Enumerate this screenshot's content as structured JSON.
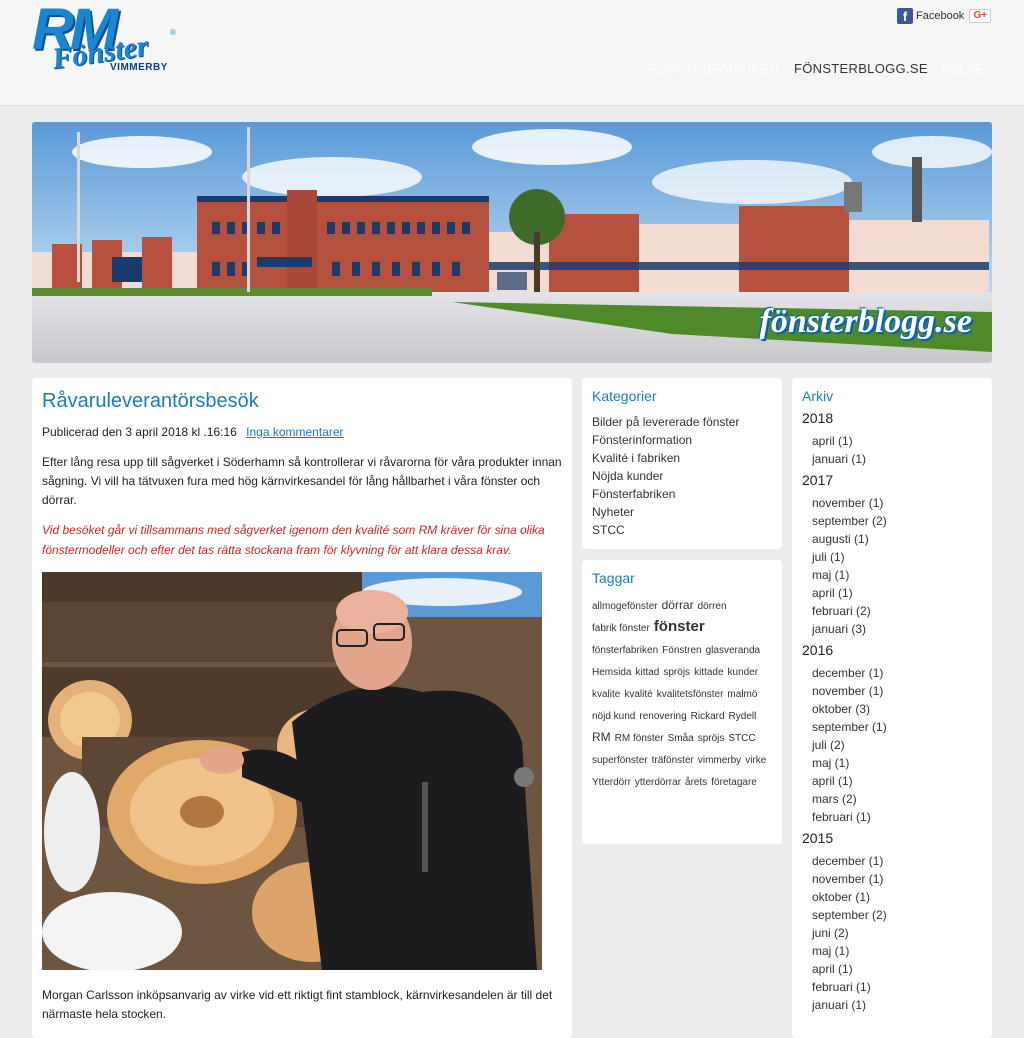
{
  "header": {
    "logo": {
      "main": "RM",
      "sub": "Fönster",
      "city": "VIMMERBY",
      "reg": "®"
    },
    "social": {
      "facebook_label": "Facebook",
      "gplus_label": "G+"
    },
    "nav": [
      {
        "label": "FÖNSTERFABRIKEN"
      },
      {
        "label": "FÖNSTERBLOGG.SE"
      },
      {
        "label": "RM.SE"
      }
    ]
  },
  "banner": {
    "caption": "fönsterblogg.se"
  },
  "post": {
    "title": "Råvaruleverantörsbesök",
    "meta": "Publicerad den 3 april 2018 kl .16:16",
    "comments_link": "Inga kommentarer",
    "body": "Efter lång resa upp till sågverket i Söderhamn så kontrollerar vi råvarorna för våra produkter innan sågning. Vi vill ha tätvuxen fura med hög kärnvirkesandel för lång hållbarhet i våra fönster och dörrar.",
    "quote": "Vid besöket går vi tillsammans med sågverket igenom den kvalité som RM kräver för sina olika fönstermodeller och efter det tas rätta stockana fram för klyvning för att klara dessa krav.",
    "caption": "Morgan Carlsson inköpsanvarig av virke vid ett riktigt fint stamblock, kärnvirkesandelen är till det närmaste hela stocken."
  },
  "categories": {
    "title": "Kategorier",
    "items": [
      "Bilder på levererade fönster",
      "Fönsterinformation",
      "Kvalité i fabriken",
      "Nöjda kunder",
      "Fönsterfabriken",
      "Nyheter",
      "STCC"
    ]
  },
  "tags": {
    "title": "Taggar",
    "items": [
      {
        "label": "allmogefönster",
        "size": "sm"
      },
      {
        "label": "dörrar",
        "size": "md"
      },
      {
        "label": "dörren",
        "size": "sm"
      },
      {
        "label": "fabrik fönster",
        "size": "sm"
      },
      {
        "label": "fönster",
        "size": "lg"
      },
      {
        "label": "fönsterfabriken",
        "size": "sm"
      },
      {
        "label": "Fönstren",
        "size": "sm"
      },
      {
        "label": "glasveranda",
        "size": "sm"
      },
      {
        "label": "Hemsida",
        "size": "sm"
      },
      {
        "label": "kittad",
        "size": "sm"
      },
      {
        "label": "spröjs",
        "size": "sm"
      },
      {
        "label": "kittade",
        "size": "sm"
      },
      {
        "label": "kunder",
        "size": "sm"
      },
      {
        "label": "kvalite",
        "size": "sm"
      },
      {
        "label": "kvalité",
        "size": "sm"
      },
      {
        "label": "kvalitetsfönster",
        "size": "sm"
      },
      {
        "label": "malmö",
        "size": "sm"
      },
      {
        "label": "nöjd kund",
        "size": "sm"
      },
      {
        "label": "renovering",
        "size": "sm"
      },
      {
        "label": "Rickard",
        "size": "sm"
      },
      {
        "label": "Rydell",
        "size": "sm"
      },
      {
        "label": "RM",
        "size": "md"
      },
      {
        "label": "RM fönster",
        "size": "sm"
      },
      {
        "label": "Småa",
        "size": "sm"
      },
      {
        "label": "spröjs",
        "size": "sm"
      },
      {
        "label": "STCC",
        "size": "sm"
      },
      {
        "label": "superfönster",
        "size": "sm"
      },
      {
        "label": "träfönster",
        "size": "sm"
      },
      {
        "label": "vimmerby",
        "size": "sm"
      },
      {
        "label": "virke",
        "size": "sm"
      },
      {
        "label": "Ytterdörr",
        "size": "sm"
      },
      {
        "label": "ytterdörrar",
        "size": "sm"
      },
      {
        "label": "årets",
        "size": "sm"
      },
      {
        "label": "företagare",
        "size": "sm"
      }
    ]
  },
  "archive": {
    "title": "Arkiv",
    "years": [
      {
        "year": "2018",
        "months": [
          "april (1)",
          "januari (1)"
        ]
      },
      {
        "year": "2017",
        "months": [
          "november (1)",
          "september (2)",
          "augusti (1)",
          "juli (1)",
          "maj (1)",
          "april (1)",
          "februari (2)",
          "januari (3)"
        ]
      },
      {
        "year": "2016",
        "months": [
          "december (1)",
          "november (1)",
          "oktober (3)",
          "september (1)",
          "juli (2)",
          "maj (1)",
          "april (1)",
          "mars (2)",
          "februari (1)"
        ]
      },
      {
        "year": "2015",
        "months": [
          "december (1)",
          "november (1)",
          "oktober (1)",
          "september (2)",
          "juni (2)",
          "maj (1)",
          "april (1)",
          "februari (1)",
          "januari (1)"
        ]
      }
    ]
  },
  "colors": {
    "accent": "#1a7bbf",
    "quote": "#d32424",
    "facebook": "#3b5998"
  }
}
